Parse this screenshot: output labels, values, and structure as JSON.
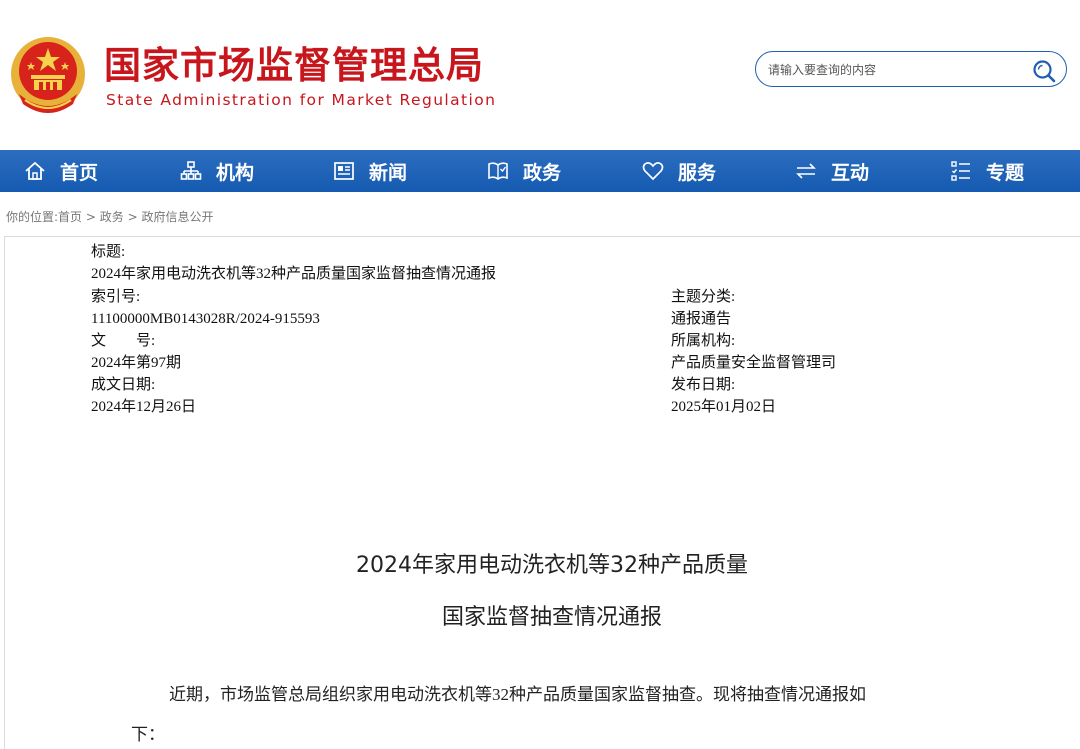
{
  "header": {
    "logo_cn": "国家市场监督管理总局",
    "logo_en": "State Administration for Market Regulation",
    "search_placeholder": "请输入要查询的内容"
  },
  "nav": [
    {
      "label": "首页",
      "icon": "home-icon"
    },
    {
      "label": "机构",
      "icon": "org-chart-icon"
    },
    {
      "label": "新闻",
      "icon": "newspaper-icon"
    },
    {
      "label": "政务",
      "icon": "book-icon"
    },
    {
      "label": "服务",
      "icon": "heart-icon"
    },
    {
      "label": "互动",
      "icon": "exchange-icon"
    },
    {
      "label": "专题",
      "icon": "topic-list-icon"
    }
  ],
  "breadcrumb": {
    "prefix": "你的位置:",
    "items": [
      "首页",
      "政务",
      "政府信息公开"
    ],
    "separator": ">"
  },
  "meta": {
    "title_label": "标题:",
    "title_value": "2024年家用电动洗衣机等32种产品质量国家监督抽查情况通报",
    "index_label": "索引号:",
    "index_value": "11100000MB0143028R/2024-915593",
    "topic_label": "主题分类:",
    "topic_value": "通报通告",
    "doc_no_label": "文　　号:",
    "doc_no_value": "2024年第97期",
    "org_label": "所属机构:",
    "org_value": "产品质量安全监督管理司",
    "written_label": "成文日期:",
    "written_value": "2024年12月26日",
    "publish_label": "发布日期:",
    "publish_value": "2025年01月02日"
  },
  "article": {
    "title_line1": "2024年家用电动洗衣机等32种产品质量",
    "title_line2": "国家监督抽查情况通报",
    "para_line1": "近期，市场监管总局组织家用电动洗衣机等32种产品质量国家监督抽查。现将抽查情况通报如",
    "para_line2": "下："
  },
  "colors": {
    "brand_red": "#c8161d",
    "nav_blue": "#1f5fb2",
    "emblem_gold": "#e8b23a"
  }
}
